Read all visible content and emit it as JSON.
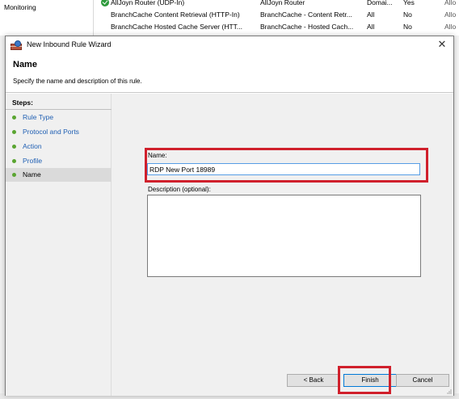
{
  "background": {
    "left_pane_label": "Monitoring",
    "rows": [
      {
        "name": "AllJoyn Router (UDP-In)",
        "group": "AllJoyn Router",
        "profile": "Domai...",
        "enabled": "Yes",
        "action": "Allo",
        "check": true
      },
      {
        "name": "BranchCache Content Retrieval (HTTP-In)",
        "group": "BranchCache - Content Retr...",
        "profile": "All",
        "enabled": "No",
        "action": "Allo",
        "check": false
      },
      {
        "name": "BranchCache Hosted Cache Server (HTT...",
        "group": "BranchCache - Hosted Cach...",
        "profile": "All",
        "enabled": "No",
        "action": "Allo",
        "check": false
      }
    ]
  },
  "wizard": {
    "title": "New Inbound Rule Wizard",
    "icon": "firewall-icon",
    "close_glyph": "✕",
    "page_title": "Name",
    "page_subtitle": "Specify the name and description of this rule.",
    "steps_title": "Steps:",
    "steps": [
      {
        "label": "Rule Type",
        "current": false
      },
      {
        "label": "Protocol and Ports",
        "current": false
      },
      {
        "label": "Action",
        "current": false
      },
      {
        "label": "Profile",
        "current": false
      },
      {
        "label": "Name",
        "current": true
      }
    ],
    "name_label": "Name:",
    "name_value": "RDP New Port 18989",
    "description_label": "Description (optional):",
    "description_value": "",
    "buttons": {
      "back": "< Back",
      "finish": "Finish",
      "cancel": "Cancel"
    },
    "highlight_color": "#d0202c"
  }
}
